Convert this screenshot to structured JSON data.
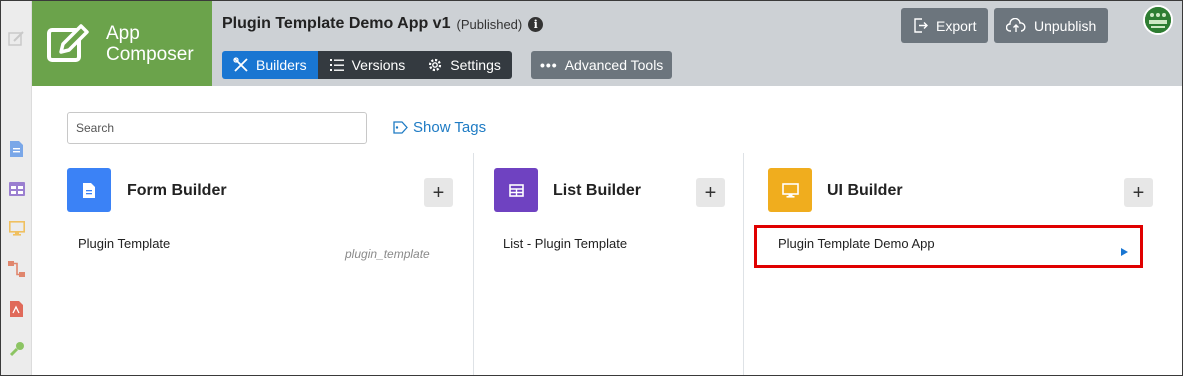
{
  "brand": {
    "line1": "App",
    "line2": "Composer"
  },
  "app": {
    "title": "Plugin Template Demo App v1",
    "status": "(Published)"
  },
  "nav": {
    "builders": "Builders",
    "versions": "Versions",
    "settings": "Settings",
    "advanced_tools": "Advanced Tools"
  },
  "actions": {
    "export": "Export",
    "unpublish": "Unpublish"
  },
  "search": {
    "placeholder": "Search",
    "show_tags": "Show Tags"
  },
  "builders": [
    {
      "title": "Form Builder",
      "color": "#3b82f6",
      "items": [
        {
          "label": "Plugin Template",
          "id": "plugin_template"
        }
      ]
    },
    {
      "title": "List Builder",
      "color": "#6f42c1",
      "items": [
        {
          "label": "List - Plugin Template"
        }
      ]
    },
    {
      "title": "UI Builder",
      "color": "#f0ad1e",
      "items": [
        {
          "label": "Plugin Template Demo App"
        }
      ]
    }
  ],
  "colors": {
    "brand": "#6ba34b",
    "header": "#cdd1d5",
    "active_tab": "#1976d2",
    "dark_tab": "#343a40",
    "highlight": "#e00000",
    "link": "#1e7bc4"
  }
}
